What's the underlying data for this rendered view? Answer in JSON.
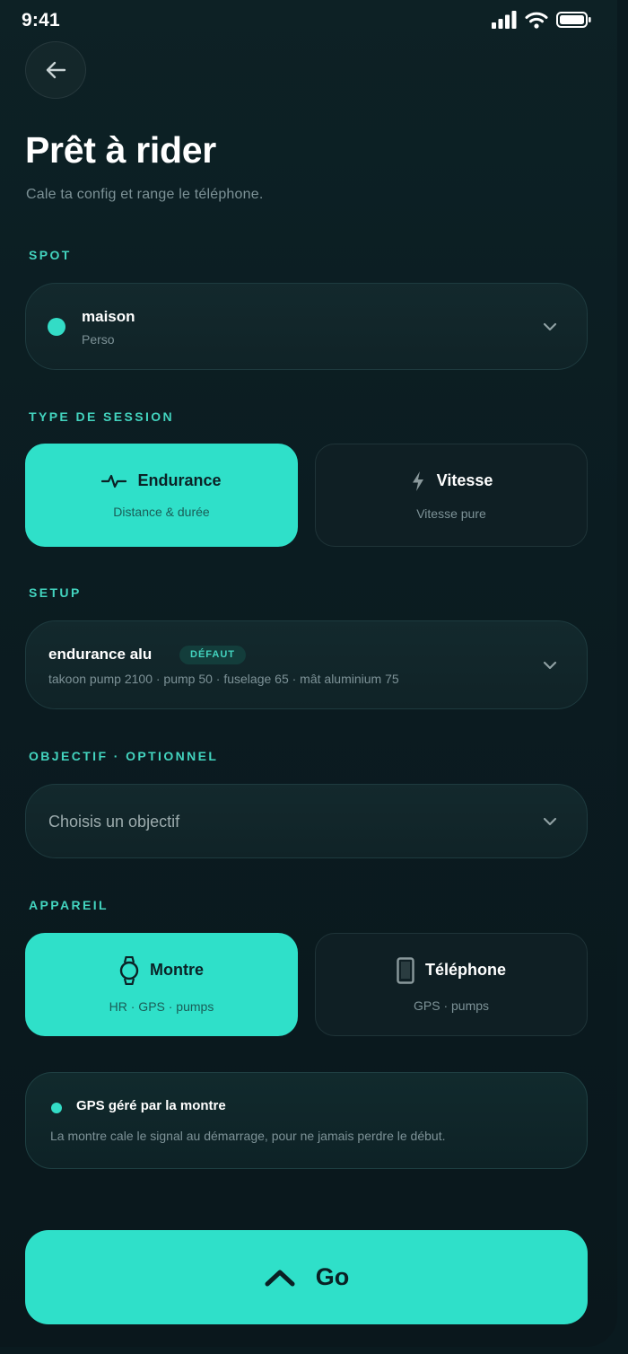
{
  "status_bar": {
    "time": "9:41"
  },
  "header": {
    "title": "Prêt à rider",
    "subtitle": "Cale ta config et range le téléphone."
  },
  "spot": {
    "section_label": "SPOT",
    "name": "maison",
    "category": "Perso"
  },
  "session_type": {
    "section_label": "TYPE DE SESSION",
    "options": [
      {
        "label": "Endurance",
        "description": "Distance & durée",
        "selected": true,
        "icon": "pulse-icon"
      },
      {
        "label": "Vitesse",
        "description": "Vitesse pure",
        "selected": false,
        "icon": "lightning-icon"
      }
    ]
  },
  "setup": {
    "section_label": "SETUP",
    "name": "endurance alu",
    "badge": "DÉFAUT",
    "details": "takoon pump 2100 · pump 50 · fuselage 65 · mât aluminium 75"
  },
  "objective": {
    "section_label": "OBJECTIF · OPTIONNEL",
    "placeholder": "Choisis un objectif"
  },
  "device": {
    "section_label": "APPAREIL",
    "options": [
      {
        "label": "Montre",
        "description": "HR · GPS · pumps",
        "selected": true,
        "icon": "watch-icon"
      },
      {
        "label": "Téléphone",
        "description": "GPS · pumps",
        "selected": false,
        "icon": "phone-icon"
      }
    ]
  },
  "gps_info": {
    "title": "GPS géré par la montre",
    "text": "La montre cale le signal au démarrage, pour ne jamais perdre le début."
  },
  "go_button": {
    "label": "Go"
  },
  "colors": {
    "accent": "#2fe0c9",
    "background": "#0b1c21",
    "card": "#13292d",
    "muted_text": "#7d9297",
    "section_label": "#43d4bf"
  }
}
